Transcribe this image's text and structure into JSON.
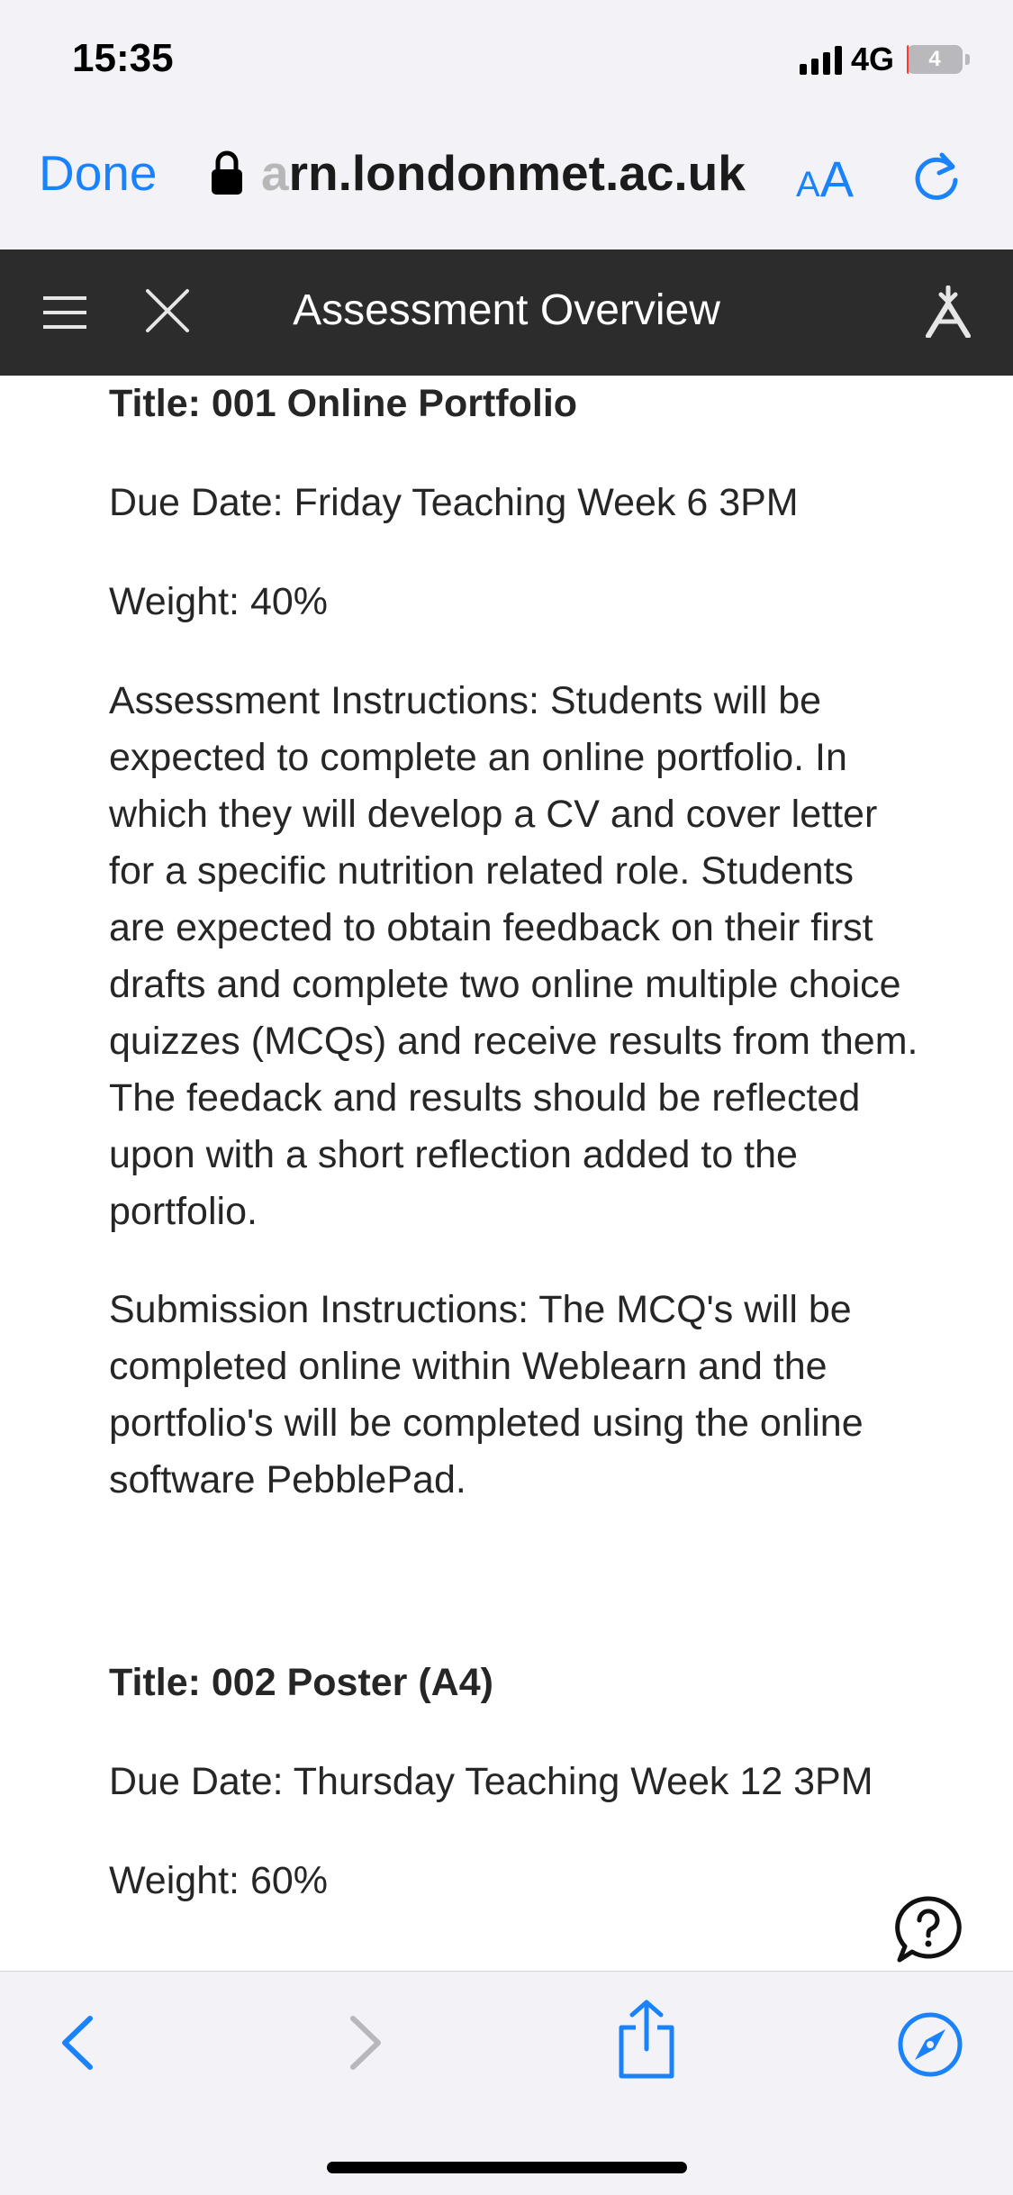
{
  "status_bar": {
    "time": "15:35",
    "network": "4G",
    "battery": "4",
    "battery_level_fraction": 0.04
  },
  "browser": {
    "done_label": "Done",
    "url_faded": "a",
    "url_main": "rn.londonmet.ac.uk",
    "text_size_label_small": "A",
    "text_size_label_big": "A"
  },
  "header": {
    "title": "Assessment Overview"
  },
  "assessments": [
    {
      "title": "Title: 001 Online Portfolio",
      "due": "Due Date: Friday Teaching Week 6 3PM",
      "weight": "Weight: 40%",
      "instructions": "Assessment Instructions: Students will be expected to complete an online portfolio. In which they will develop a CV and cover letter for a specific nutrition related role. Students are expected to obtain feedback on their first drafts and complete two online multiple choice quizzes (MCQs) and receive results from them. The feedack and results should be reflected upon with a short reflection added to the portfolio.",
      "submission": "Submission Instructions: The MCQ's will be completed online within Weblearn and the portfolio's will be completed using the online software PebblePad."
    },
    {
      "title": "Title: 002 Poster (A4)",
      "due": "Due Date: Thursday Teaching Week 12 3PM",
      "weight": "Weight: 60%"
    }
  ],
  "colors": {
    "accent": "#1a82fb",
    "header_bg": "#2c2c2c",
    "chrome_bg": "#f2f2f7"
  },
  "icons": {
    "lock": "lock-icon",
    "reload": "reload-icon",
    "menu": "menu-icon",
    "close": "close-icon",
    "accessibility": "accessibility-icon",
    "help": "help-icon",
    "back": "chevron-left-icon",
    "forward": "chevron-right-icon",
    "share": "share-icon",
    "compass": "compass-icon"
  }
}
